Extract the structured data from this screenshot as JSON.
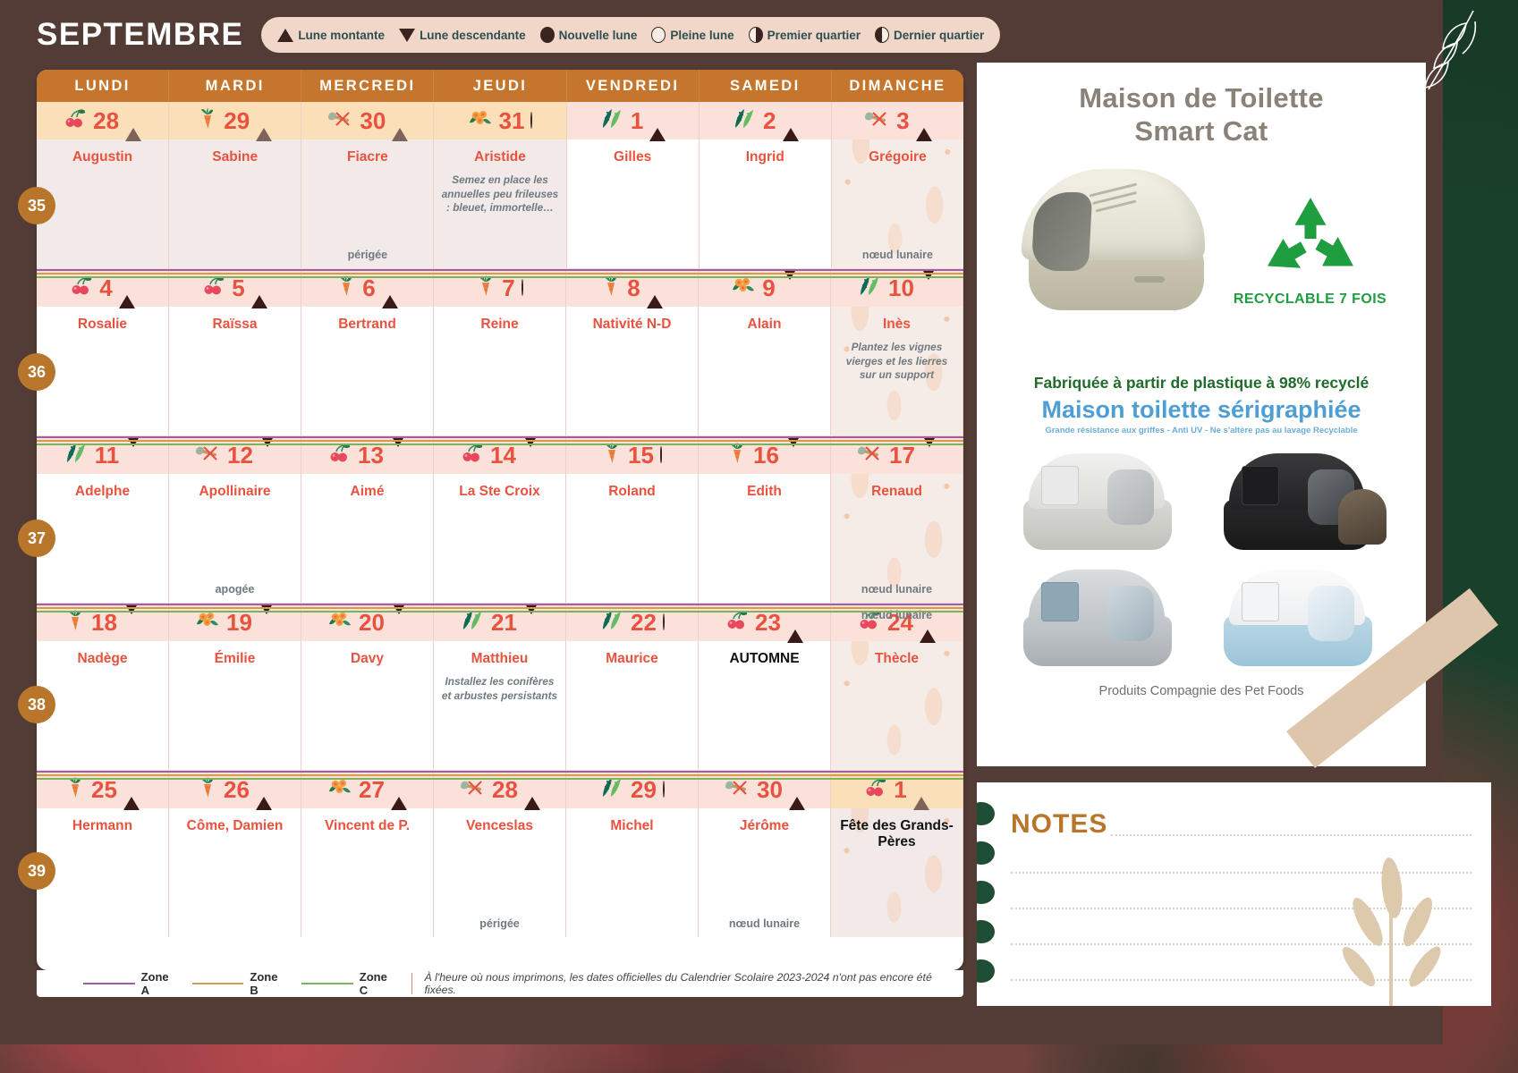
{
  "header": {
    "month": "SEPTEMBRE",
    "moon_legend": [
      {
        "icon": "triangle-up-icon",
        "label": "Lune montante"
      },
      {
        "icon": "triangle-down-icon",
        "label": "Lune descendante"
      },
      {
        "icon": "new-moon-icon",
        "label": "Nouvelle lune"
      },
      {
        "icon": "full-moon-icon",
        "label": "Pleine lune"
      },
      {
        "icon": "first-quarter-icon",
        "label": "Premier quartier"
      },
      {
        "icon": "last-quarter-icon",
        "label": "Dernier quartier"
      }
    ]
  },
  "calendar": {
    "day_headers": [
      "LUNDI",
      "MARDI",
      "MERCREDI",
      "JEUDI",
      "VENDREDI",
      "SAMEDI",
      "DIMANCHE"
    ],
    "weeks": [
      {
        "number": "35",
        "days": [
          {
            "num": "28",
            "saint": "Augustin",
            "veg": "cherries-icon",
            "phase": "triangle-up-icon",
            "prev_month": true,
            "note": "",
            "lunar": ""
          },
          {
            "num": "29",
            "saint": "Sabine",
            "veg": "carrot-icon",
            "phase": "triangle-up-icon",
            "prev_month": true,
            "note": "",
            "lunar": ""
          },
          {
            "num": "30",
            "saint": "Fiacre",
            "veg": "trowel-icon",
            "phase": "triangle-up-icon",
            "prev_month": true,
            "note": "",
            "lunar": "périgée"
          },
          {
            "num": "31",
            "saint": "Aristide",
            "veg": "flowers-icon",
            "phase": "full-moon-icon",
            "prev_month": true,
            "note": "Semez en place les annuelles peu frileuses : bleuet, immortelle…",
            "lunar": ""
          },
          {
            "num": "1",
            "saint": "Gilles",
            "veg": "leaves-icon",
            "phase": "triangle-up-icon",
            "prev_month": false,
            "note": "",
            "lunar": ""
          },
          {
            "num": "2",
            "saint": "Ingrid",
            "veg": "leaves-icon",
            "phase": "triangle-up-icon",
            "prev_month": false,
            "note": "",
            "lunar": ""
          },
          {
            "num": "3",
            "saint": "Grégoire",
            "veg": "trowel-icon",
            "phase": "triangle-up-icon",
            "prev_month": false,
            "note": "",
            "lunar": "nœud lunaire"
          }
        ]
      },
      {
        "number": "36",
        "days": [
          {
            "num": "4",
            "saint": "Rosalie",
            "veg": "cherries-icon",
            "phase": "triangle-up-icon",
            "prev_month": false,
            "note": "",
            "lunar": ""
          },
          {
            "num": "5",
            "saint": "Raïssa",
            "veg": "cherries-icon",
            "phase": "triangle-up-icon",
            "prev_month": false,
            "note": "",
            "lunar": ""
          },
          {
            "num": "6",
            "saint": "Bertrand",
            "veg": "carrot-icon",
            "phase": "triangle-up-icon",
            "prev_month": false,
            "note": "",
            "lunar": ""
          },
          {
            "num": "7",
            "saint": "Reine",
            "veg": "carrot-icon",
            "phase": "last-quarter-icon",
            "prev_month": false,
            "note": "",
            "lunar": ""
          },
          {
            "num": "8",
            "saint": "Nativité N-D",
            "veg": "carrot-icon",
            "phase": "triangle-up-icon",
            "prev_month": false,
            "note": "",
            "lunar": ""
          },
          {
            "num": "9",
            "saint": "Alain",
            "veg": "flowers-icon",
            "phase": "triangle-down-icon",
            "prev_month": false,
            "note": "",
            "lunar": ""
          },
          {
            "num": "10",
            "saint": "Inès",
            "veg": "leaves-icon",
            "phase": "triangle-down-icon",
            "prev_month": false,
            "note": "Plantez les vignes vierges et les lierres sur un support",
            "lunar": ""
          }
        ]
      },
      {
        "number": "37",
        "days": [
          {
            "num": "11",
            "saint": "Adelphe",
            "veg": "leaves-icon",
            "phase": "triangle-down-icon",
            "prev_month": false,
            "note": "",
            "lunar": ""
          },
          {
            "num": "12",
            "saint": "Apollinaire",
            "veg": "trowel-icon",
            "phase": "triangle-down-icon",
            "prev_month": false,
            "note": "",
            "lunar": "apogée"
          },
          {
            "num": "13",
            "saint": "Aimé",
            "veg": "cherries-icon",
            "phase": "triangle-down-icon",
            "prev_month": false,
            "note": "",
            "lunar": ""
          },
          {
            "num": "14",
            "saint": "La Ste Croix",
            "veg": "cherries-icon",
            "phase": "triangle-down-icon",
            "prev_month": false,
            "note": "",
            "lunar": ""
          },
          {
            "num": "15",
            "saint": "Roland",
            "veg": "carrot-icon",
            "phase": "new-moon-icon",
            "prev_month": false,
            "note": "",
            "lunar": ""
          },
          {
            "num": "16",
            "saint": "Edith",
            "veg": "carrot-icon",
            "phase": "triangle-down-icon",
            "prev_month": false,
            "note": "",
            "lunar": ""
          },
          {
            "num": "17",
            "saint": "Renaud",
            "veg": "trowel-icon",
            "phase": "triangle-down-icon",
            "prev_month": false,
            "note": "",
            "lunar": "nœud lunaire"
          }
        ]
      },
      {
        "number": "38",
        "days": [
          {
            "num": "18",
            "saint": "Nadège",
            "veg": "carrot-icon",
            "phase": "triangle-down-icon",
            "prev_month": false,
            "note": "",
            "lunar": ""
          },
          {
            "num": "19",
            "saint": "Émilie",
            "veg": "flowers-icon",
            "phase": "triangle-down-icon",
            "prev_month": false,
            "note": "",
            "lunar": ""
          },
          {
            "num": "20",
            "saint": "Davy",
            "veg": "flowers-icon",
            "phase": "triangle-down-icon",
            "prev_month": false,
            "note": "",
            "lunar": ""
          },
          {
            "num": "21",
            "saint": "Matthieu",
            "veg": "leaves-icon",
            "phase": "triangle-down-icon",
            "prev_month": false,
            "note": "Installez les conifères et arbustes persistants",
            "lunar": ""
          },
          {
            "num": "22",
            "saint": "Maurice",
            "veg": "leaves-icon",
            "phase": "last-quarter-icon",
            "prev_month": false,
            "note": "",
            "lunar": ""
          },
          {
            "num": "23",
            "saint": "AUTOMNE",
            "veg": "cherries-icon",
            "phase": "triangle-up-icon",
            "prev_month": false,
            "note": "",
            "lunar": "",
            "saint_black": true
          },
          {
            "num": "24",
            "saint": "Thècle",
            "veg": "cherries-icon",
            "phase": "triangle-up-icon",
            "prev_month": false,
            "note": "",
            "lunar": "nœud lunaire",
            "lunar_top": true
          }
        ]
      },
      {
        "number": "39",
        "days": [
          {
            "num": "25",
            "saint": "Hermann",
            "veg": "carrot-icon",
            "phase": "triangle-up-icon",
            "prev_month": false,
            "note": "",
            "lunar": ""
          },
          {
            "num": "26",
            "saint": "Côme, Damien",
            "veg": "carrot-icon",
            "phase": "triangle-up-icon",
            "prev_month": false,
            "note": "",
            "lunar": ""
          },
          {
            "num": "27",
            "saint": "Vincent de P.",
            "veg": "flowers-icon",
            "phase": "triangle-up-icon",
            "prev_month": false,
            "note": "",
            "lunar": ""
          },
          {
            "num": "28",
            "saint": "Venceslas",
            "veg": "trowel-icon",
            "phase": "triangle-up-icon",
            "prev_month": false,
            "note": "",
            "lunar": "périgée"
          },
          {
            "num": "29",
            "saint": "Michel",
            "veg": "leaves-icon",
            "phase": "full-moon-icon",
            "prev_month": false,
            "note": "",
            "lunar": ""
          },
          {
            "num": "30",
            "saint": "Jérôme",
            "veg": "trowel-icon",
            "phase": "triangle-up-icon",
            "prev_month": false,
            "note": "",
            "lunar": "nœud lunaire"
          },
          {
            "num": "1",
            "saint": "Fête des Grands-Pères",
            "veg": "cherries-icon",
            "phase": "triangle-up-icon",
            "prev_month": true,
            "note": "",
            "lunar": "",
            "saint_black": true
          }
        ]
      }
    ]
  },
  "footer": {
    "zones": [
      {
        "label": "Zone A",
        "color": "#9e5fa8"
      },
      {
        "label": "Zone B",
        "color": "#d79a46"
      },
      {
        "label": "Zone C",
        "color": "#79b45c"
      }
    ],
    "disclaimer": "À l'heure où nous imprimons, les dates officielles du Calendrier Scolaire 2023-2024 n'ont pas encore été fixées."
  },
  "ad": {
    "title_line1": "Maison de Toilette",
    "title_line2": "Smart Cat",
    "recycle_badge": "RECYCLABLE 7 FOIS",
    "green_claim": "Fabriquée à partir de plastique à 98% recyclé",
    "blue_claim": "Maison toilette sérigraphiée",
    "blue_sub": "Grande résistance aux griffes - Anti UV - Ne s'altère pas au lavage Recyclable",
    "brand_footer": "Produits Compagnie des Pet Foods"
  },
  "notes": {
    "title": "NOTES"
  },
  "colors": {
    "brand_brown": "#533c36",
    "header_orange": "#c5762c",
    "day_number_red": "#e8523f",
    "week_badge": "#b8762a",
    "highlight_peach": "#fbdfb8",
    "row_band": "#fae2db"
  }
}
